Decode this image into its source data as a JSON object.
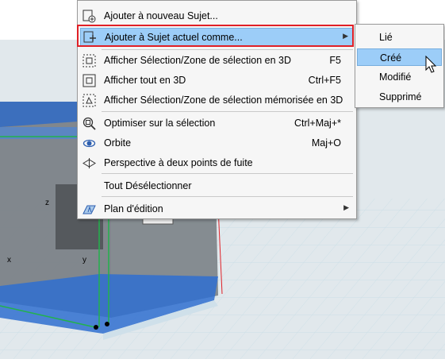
{
  "context_menu": {
    "items": [
      {
        "label": "Ajouter à nouveau Sujet...",
        "shortcut": "",
        "icon": "new-issue-icon"
      },
      {
        "label": "Ajouter à Sujet actuel comme...",
        "shortcut": "",
        "icon": "current-issue-icon",
        "highlighted": true,
        "submenu": true
      },
      {
        "label": "Afficher Sélection/Zone de sélection en 3D",
        "shortcut": "F5",
        "icon": "show-selection-3d-icon"
      },
      {
        "label": "Afficher tout en 3D",
        "shortcut": "Ctrl+F5",
        "icon": "show-all-3d-icon"
      },
      {
        "label": "Afficher Sélection/Zone de sélection mémorisée en 3D",
        "shortcut": "",
        "icon": "show-stored-selection-3d-icon"
      },
      {
        "label": "Optimiser sur la sélection",
        "shortcut": "Ctrl+Maj+*",
        "icon": "zoom-to-selection-icon"
      },
      {
        "label": "Orbite",
        "shortcut": "Maj+O",
        "icon": "orbit-icon"
      },
      {
        "label": "Perspective à deux points de fuite",
        "shortcut": "",
        "icon": "two-point-perspective-icon"
      },
      {
        "label": "Tout Désélectionner",
        "shortcut": "",
        "icon": ""
      },
      {
        "label": "Plan d'édition",
        "shortcut": "",
        "icon": "editing-plane-icon",
        "submenu": true
      }
    ]
  },
  "submenu": {
    "items": [
      {
        "label": "Lié"
      },
      {
        "label": "Créé",
        "highlighted": true
      },
      {
        "label": "Modifié"
      },
      {
        "label": "Supprimé"
      }
    ]
  },
  "viewport": {
    "axis_labels": {
      "z": "z",
      "x": "x",
      "y": "y"
    }
  },
  "colors": {
    "highlight": "#9ccdf8",
    "callout_border": "#e02027",
    "selection_blue": "#2f6fd0",
    "edge_green": "#22b24c"
  }
}
